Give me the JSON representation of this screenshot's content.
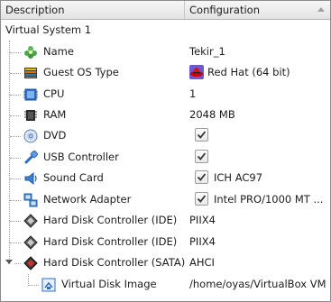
{
  "header": {
    "description_label": "Description",
    "configuration_label": "Configuration"
  },
  "root": {
    "label": "Virtual System 1"
  },
  "items": [
    {
      "label": "Name",
      "value": "Tekir_1",
      "icon": "name-icon"
    },
    {
      "label": "Guest OS Type",
      "value": "Red Hat (64 bit)",
      "icon": "os-type-icon",
      "value_icon": "redhat-icon"
    },
    {
      "label": "CPU",
      "value": "1",
      "icon": "cpu-icon"
    },
    {
      "label": "RAM",
      "value": "2048 MB",
      "icon": "ram-icon"
    },
    {
      "label": "DVD",
      "value": "",
      "icon": "dvd-icon",
      "checked": true
    },
    {
      "label": "USB Controller",
      "value": "",
      "icon": "usb-icon",
      "checked": true
    },
    {
      "label": "Sound Card",
      "value": "ICH AC97",
      "icon": "sound-card-icon",
      "checked": true
    },
    {
      "label": "Network Adapter",
      "value": "Intel PRO/1000 MT ...",
      "icon": "network-adapter-icon",
      "checked": true
    },
    {
      "label": "Hard Disk Controller (IDE)",
      "value": "PIIX4",
      "icon": "disk-controller-icon"
    },
    {
      "label": "Hard Disk Controller (IDE)",
      "value": "PIIX4",
      "icon": "disk-controller-icon"
    },
    {
      "label": "Hard Disk Controller (SATA)",
      "value": "AHCI",
      "icon": "disk-controller-sata-icon",
      "expanded": true
    },
    {
      "label": "Virtual Disk Image",
      "value": "/home/oyas/VirtualBox VM...",
      "icon": "virtual-disk-icon",
      "child": true
    }
  ]
}
